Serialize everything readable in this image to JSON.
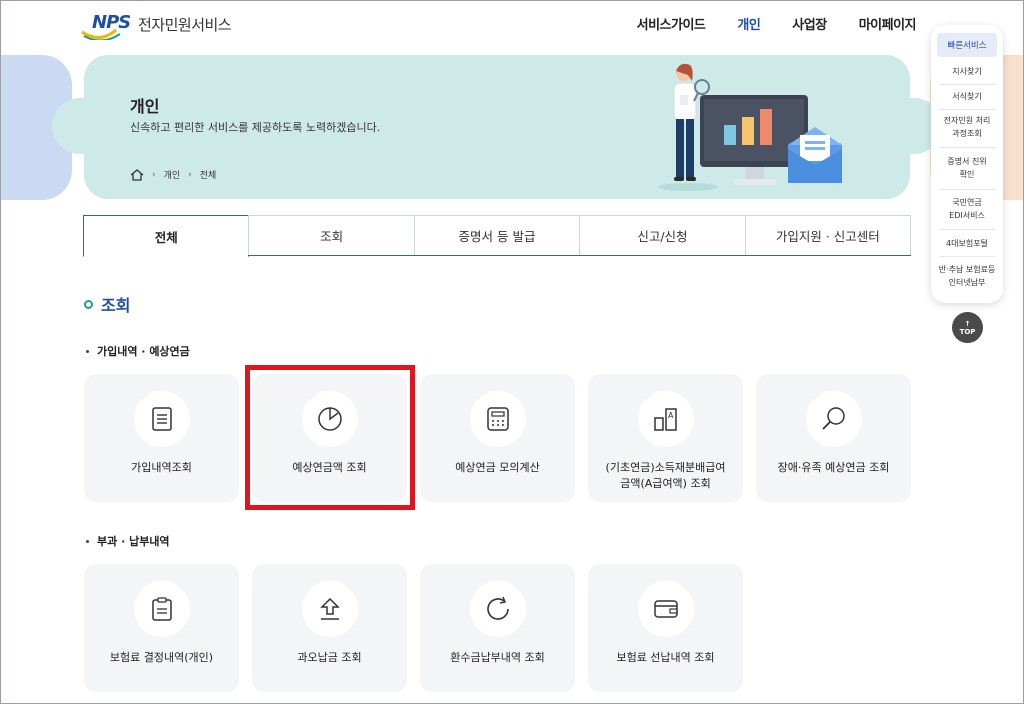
{
  "header": {
    "logo_mark": "NPS",
    "logo_text": "전자민원서비스",
    "nav": [
      "서비스가이드",
      "개인",
      "사업장",
      "마이페이지"
    ]
  },
  "banner": {
    "title": "개인",
    "description": "신속하고 편리한 서비스를 제공하도록 노력하겠습니다.",
    "breadcrumb": [
      "개인",
      "전체"
    ]
  },
  "tabs": [
    "전체",
    "조회",
    "증명서 등 발급",
    "신고/신청",
    "가입지원 · 신고센터"
  ],
  "section": {
    "title": "조회",
    "groups": [
      {
        "title": "가입내역 · 예상연금",
        "items": [
          {
            "label": "가입내역조회",
            "icon": "document-list-icon"
          },
          {
            "label": "예상연금액 조회",
            "icon": "pie-chart-icon"
          },
          {
            "label": "예상연금 모의계산",
            "icon": "calculator-icon"
          },
          {
            "label": "(기초연금)소득재분배급여 금액(A급여액) 조회",
            "icon": "bar-a-icon"
          },
          {
            "label": "장애·유족 예상연금 조회",
            "icon": "magnifier-icon"
          }
        ]
      },
      {
        "title": "부과 · 납부내역",
        "items": [
          {
            "label": "보험료 결정내역(개인)",
            "icon": "clipboard-icon"
          },
          {
            "label": "과오납금 조회",
            "icon": "upload-arrow-icon"
          },
          {
            "label": "환수금납부내역 조회",
            "icon": "refresh-icon"
          },
          {
            "label": "보험료 선납내역 조회",
            "icon": "wallet-icon"
          }
        ]
      }
    ]
  },
  "quick_menu": {
    "title": "빠른서비스",
    "items": [
      "지사찾기",
      "서식찾기",
      "전자민원 처리과정조회",
      "증명서 진위확인",
      "국민연금 EDI서비스",
      "4대보험포털",
      "반·추납 보험료등 인터넷납부"
    ],
    "top_label": "TOP"
  },
  "colors": {
    "brand": "#1f4ea3",
    "banner_bg": "#cdeae8",
    "highlight": "#e0161e",
    "card_bg": "#f4f5f7"
  }
}
